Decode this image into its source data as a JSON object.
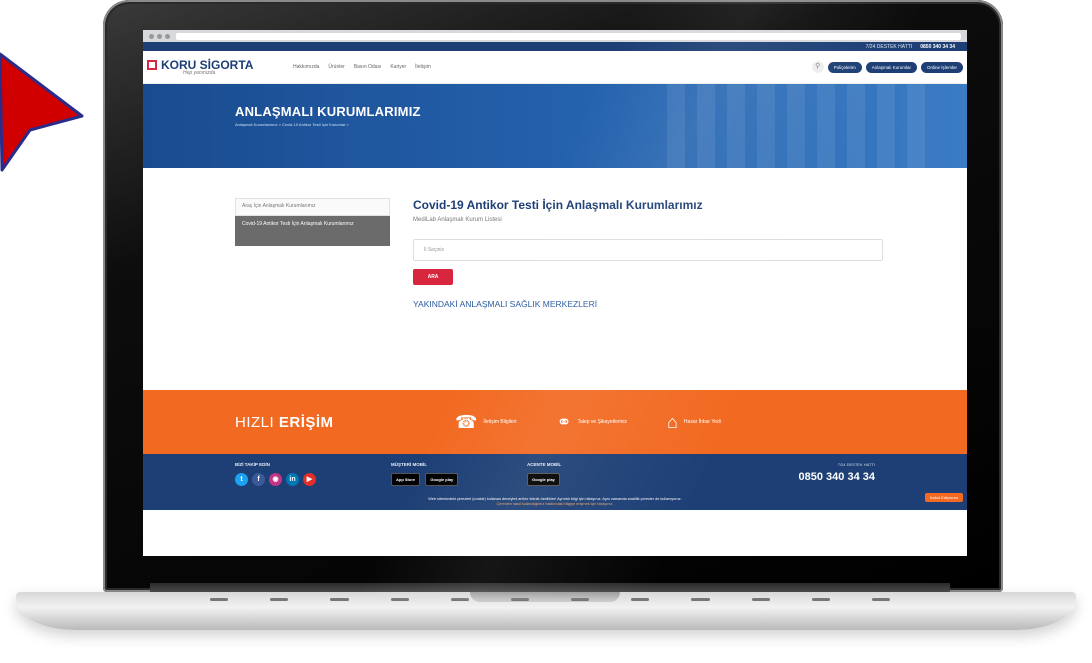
{
  "colors": {
    "brand_blue": "#1d3f75",
    "accent_red": "#d7263d",
    "orange": "#f26a22",
    "arrow_red": "#d10000"
  },
  "browser": {
    "url": ""
  },
  "utility": {
    "hotline_label": "7/24 DESTEK HATTI",
    "hotline_number": "0850 340 34 34"
  },
  "header": {
    "logo_name": "KORU SİGORTA",
    "logo_tagline": "Hep yanınızda",
    "nav": [
      "Hakkımızda",
      "Ürünler",
      "Basın Odası",
      "Kariyer",
      "İletişim"
    ],
    "buttons": [
      "Poliçelerim",
      "Anlaşmalı Kurumlar",
      "Online İşlemler"
    ]
  },
  "hero": {
    "title": "ANLAŞMALI KURUMLARIMIZ",
    "breadcrumb": "Anlaşmalı Kurumlarımız > Covid-19 Antikor Testi İçin Kurumlar >"
  },
  "sidebar": {
    "items": [
      {
        "label": "Araç İçin Anlaşmalı Kurumlarımız"
      },
      {
        "label": "Covid-19 Antikor Testi İçin Anlaşmalı Kurumlarımız"
      }
    ]
  },
  "main": {
    "title": "Covid-19 Antikor Testi İçin Anlaşmalı Kurumlarımız",
    "subtitle": "MediLab Anlaşmalı Kurum Listesi",
    "city_placeholder": "İl Seçiniz",
    "search_button": "ARA",
    "nearby_title": "YAKINDAKİ ANLAŞMALI SAĞLIK MERKEZLERİ"
  },
  "quick_access": {
    "title_thin": "HIZLI",
    "title_bold": "ERİŞİM",
    "items": [
      {
        "label": "İletişim Bilgileri",
        "icon": "phone-icon"
      },
      {
        "label": "Talep ve Şikayetleriniz",
        "icon": "headset-icon"
      },
      {
        "label": "Hasar İhbar Yedi",
        "icon": "house-icon"
      }
    ]
  },
  "footer": {
    "follow_label": "BİZİ TAKİP EDİN",
    "mobile_label": "MÜŞTERİ MOBİL",
    "agent_label": "ACENTE MOBİL",
    "app_store": "App Store",
    "google_play": "Google play",
    "hotline_label": "7/24 DESTEK HATTI",
    "hotline_number": "0850 340 34 34",
    "cookie_line1": "Web sitemizdeki çerezleri (cookie) kullanan deneyimi arttırır teknik özellikler! Ayrıntılı bilgi için tıklayınız. Aynı zamanda analitik çerezler de kullanıyoruz.",
    "cookie_line2": "Çerezleri nasıl kullandığımız hakkındaki bilgiye erişmek için tıklayınız.",
    "cookie_button": "Kabul Ediyorum"
  }
}
